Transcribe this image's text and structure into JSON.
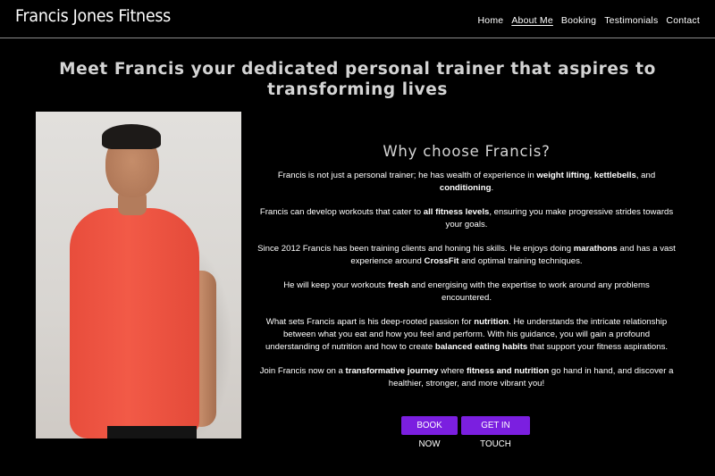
{
  "header": {
    "brand": "Francis Jones Fitness",
    "nav": [
      {
        "label": "Home",
        "active": false
      },
      {
        "label": "About Me",
        "active": true
      },
      {
        "label": "Booking",
        "active": false
      },
      {
        "label": "Testimonials",
        "active": false
      },
      {
        "label": "Contact",
        "active": false
      }
    ]
  },
  "main": {
    "headline": "Meet Francis your dedicated personal trainer that aspires to transforming lives",
    "section_title": "Why choose Francis?",
    "paragraphs": [
      [
        {
          "t": "Francis is not just a personal trainer; he has wealth of experience in "
        },
        {
          "t": "weight lifting",
          "b": true
        },
        {
          "t": ", "
        },
        {
          "t": "kettlebells",
          "b": true
        },
        {
          "t": ", and "
        },
        {
          "t": "conditioning",
          "b": true
        },
        {
          "t": "."
        }
      ],
      [
        {
          "t": "Francis can develop workouts that cater to "
        },
        {
          "t": "all fitness levels",
          "b": true
        },
        {
          "t": ", ensuring you make progressive strides towards your goals."
        }
      ],
      [
        {
          "t": "Since 2012 Francis has been training clients and honing his skills. He enjoys doing "
        },
        {
          "t": "marathons",
          "b": true
        },
        {
          "t": " and has a vast experience around "
        },
        {
          "t": "CrossFit",
          "b": true
        },
        {
          "t": " and optimal training techniques."
        }
      ],
      [
        {
          "t": "He will keep your workouts "
        },
        {
          "t": "fresh",
          "b": true
        },
        {
          "t": " and energising with the expertise to work around any problems encountered."
        }
      ],
      [
        {
          "t": "What sets Francis apart is his deep-rooted passion for "
        },
        {
          "t": "nutrition",
          "b": true
        },
        {
          "t": ". He understands the intricate relationship between what you eat and how you feel and perform. With his guidance, you will gain a profound understanding of nutrition and how to create "
        },
        {
          "t": "balanced eating habits",
          "b": true
        },
        {
          "t": " that support your fitness aspirations."
        }
      ],
      [
        {
          "t": "Join Francis now on a "
        },
        {
          "t": "transformative journey",
          "b": true
        },
        {
          "t": " where "
        },
        {
          "t": "fitness and nutrition",
          "b": true
        },
        {
          "t": " go hand in hand, and discover a healthier, stronger, and more vibrant you!"
        }
      ]
    ],
    "buttons": {
      "book": "BOOK NOW",
      "touch": "GET IN TOUCH"
    }
  },
  "colors": {
    "background": "#000000",
    "accent_button": "#7b1fe0",
    "headline": "#d4d4d4"
  }
}
